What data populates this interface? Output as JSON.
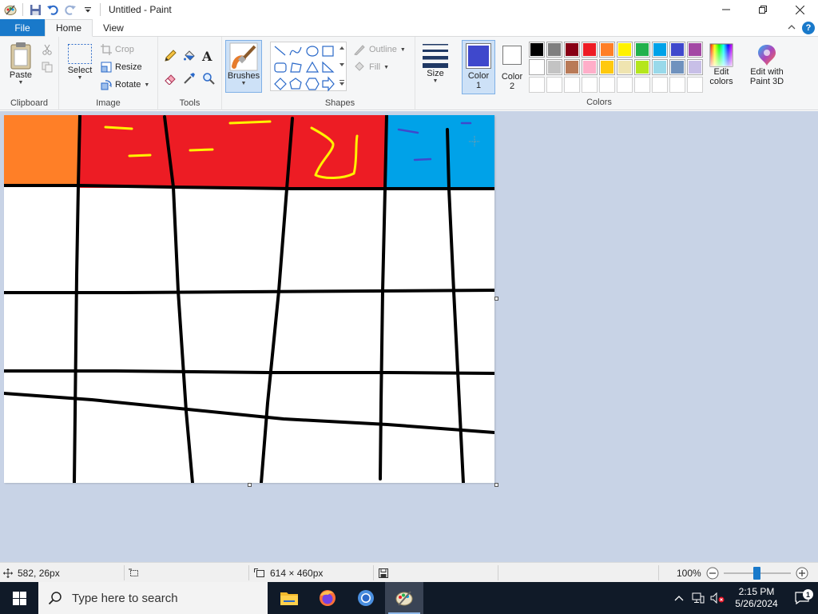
{
  "window": {
    "title": "Untitled - Paint"
  },
  "tabs": {
    "file": "File",
    "home": "Home",
    "view": "View"
  },
  "ribbon": {
    "clipboard": {
      "label": "Clipboard",
      "paste": "Paste"
    },
    "image": {
      "label": "Image",
      "select": "Select",
      "crop": "Crop",
      "resize": "Resize",
      "rotate": "Rotate"
    },
    "tools": {
      "label": "Tools"
    },
    "brushes": {
      "label": "Brushes"
    },
    "shapes": {
      "label": "Shapes",
      "outline": "Outline",
      "fill": "Fill"
    },
    "size": {
      "label": "Size"
    },
    "color1": {
      "label": "Color",
      "num": "1",
      "color": "#3f48cc"
    },
    "color2": {
      "label": "Color",
      "num": "2",
      "color": "#ffffff"
    },
    "colors": {
      "label": "Colors"
    },
    "edit_colors": {
      "line1": "Edit",
      "line2": "colors"
    },
    "paint3d": {
      "line1": "Edit with",
      "line2": "Paint 3D"
    },
    "palette_row1": [
      "#000000",
      "#7f7f7f",
      "#880015",
      "#ed1c24",
      "#ff7f27",
      "#fff200",
      "#22b14c",
      "#00a2e8",
      "#3f48cc",
      "#a349a4"
    ],
    "palette_row2": [
      "#ffffff",
      "#c3c3c3",
      "#b97a57",
      "#ffaec9",
      "#ffc90e",
      "#efe4b0",
      "#b5e61d",
      "#99d9ea",
      "#7092be",
      "#c8bfe7"
    ],
    "palette_row3": [
      "#ffffff",
      "#ffffff",
      "#ffffff",
      "#ffffff",
      "#ffffff",
      "#ffffff",
      "#ffffff",
      "#ffffff",
      "#ffffff",
      "#ffffff"
    ]
  },
  "canvas": {
    "colors": {
      "orange": "#ff7f27",
      "red": "#ed1c24",
      "blue": "#00a2e8",
      "yellow": "#fff200",
      "ink": "#3f48cc",
      "line": "#000000"
    }
  },
  "status": {
    "cursor_pos": "582, 26px",
    "canvas_size": "614 × 460px",
    "zoom": "100%",
    "zoom_level": 0.5
  },
  "taskbar": {
    "search_placeholder": "Type here to search",
    "time": "2:15 PM",
    "date": "5/26/2024",
    "notifications": "1"
  }
}
